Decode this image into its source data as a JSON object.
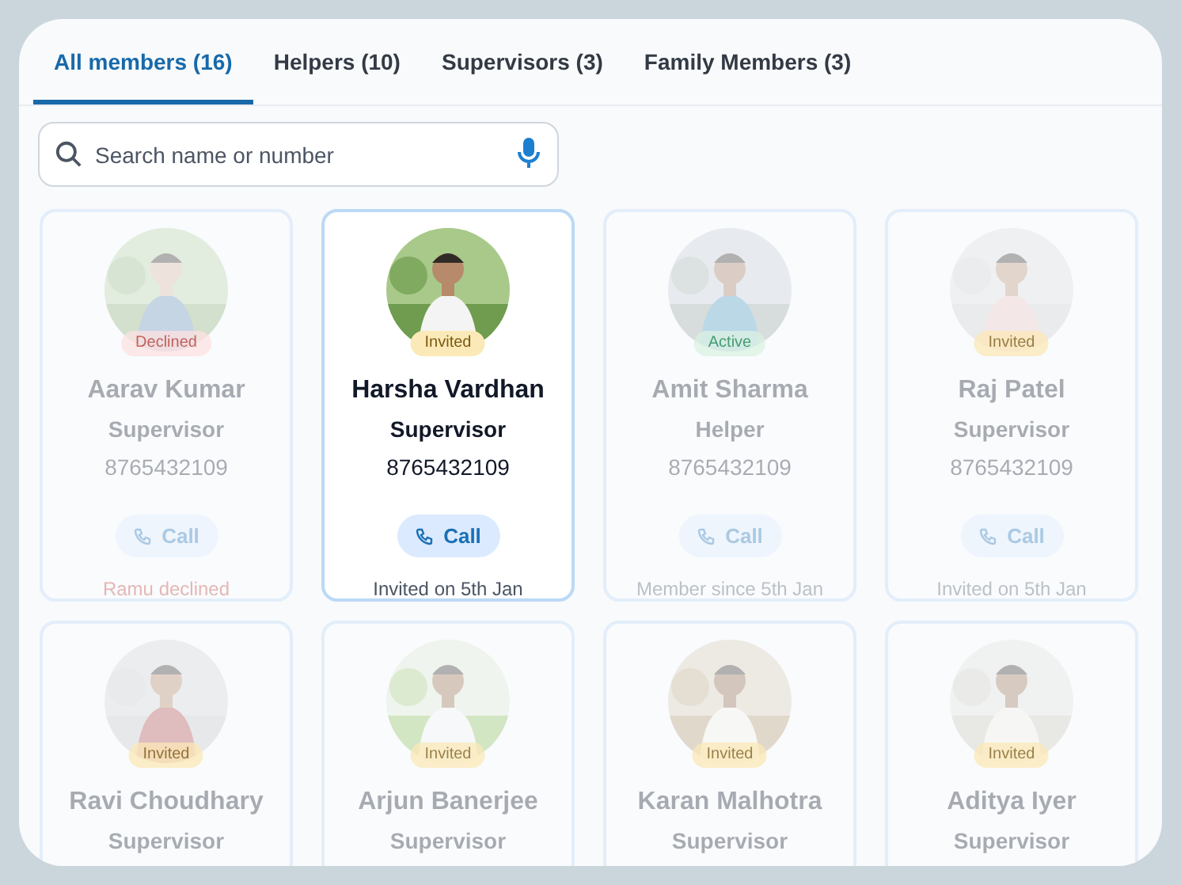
{
  "tabs": [
    {
      "label": "All members (16)",
      "selected": true
    },
    {
      "label": "Helpers (10)",
      "selected": false
    },
    {
      "label": "Supervisors (3)",
      "selected": false
    },
    {
      "label": "Family Members (3)",
      "selected": false
    }
  ],
  "search": {
    "placeholder": "Search name or number"
  },
  "members": [
    {
      "name": "Aarav Kumar",
      "role": "Supervisor",
      "phone": "8765432109",
      "status": "Declined",
      "kind": "declined",
      "call": "Call",
      "note": "Ramu declined",
      "selected": false
    },
    {
      "name": "Harsha Vardhan",
      "role": "Supervisor",
      "phone": "8765432109",
      "status": "Invited",
      "kind": "invited",
      "call": "Call",
      "note": "Invited on 5th Jan",
      "selected": true
    },
    {
      "name": "Amit Sharma",
      "role": "Helper",
      "phone": "8765432109",
      "status": "Active",
      "kind": "active",
      "call": "Call",
      "note": "Member since 5th Jan",
      "selected": false
    },
    {
      "name": "Raj Patel",
      "role": "Supervisor",
      "phone": "8765432109",
      "status": "Invited",
      "kind": "invited",
      "call": "Call",
      "note": "Invited on 5th Jan",
      "selected": false
    },
    {
      "name": "Ravi Choudhary",
      "role": "Supervisor",
      "status": "Invited",
      "kind": "invited",
      "selected": false
    },
    {
      "name": "Arjun Banerjee",
      "role": "Supervisor",
      "status": "Invited",
      "kind": "invited",
      "selected": false
    },
    {
      "name": "Karan Malhotra",
      "role": "Supervisor",
      "status": "Invited",
      "kind": "invited",
      "selected": false
    },
    {
      "name": "Aditya Iyer",
      "role": "Supervisor",
      "status": "Invited",
      "kind": "invited",
      "selected": false
    }
  ]
}
